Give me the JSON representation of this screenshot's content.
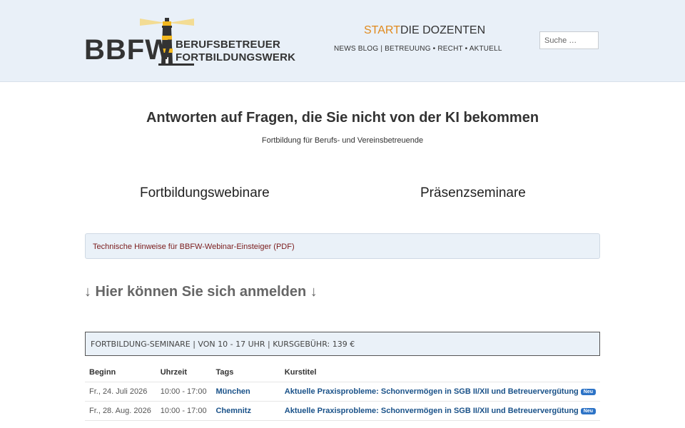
{
  "header": {
    "logo": {
      "mark": "BBFW",
      "line1": "BERUFSBETREUER",
      "line2": "FORTBILDUNGSWERK"
    },
    "nav": {
      "start": "START",
      "dozenten": "DIE DOZENTEN",
      "secondary": "NEWS BLOG | BETREUUNG • RECHT • AKTUELL"
    },
    "search": {
      "placeholder": "Suche …"
    },
    "colors": {
      "active": "#e08a1e",
      "background": "#e9f0f8"
    }
  },
  "main": {
    "headline": "Antworten auf Fragen, die Sie nicht von der KI bekommen",
    "subline": "Fortbildung für Berufs- und Vereinsbetreuende",
    "col_left": "Fortbildungswebinare",
    "col_right": "Präsenzseminare",
    "notice_link": "Technische Hinweise für BBFW-Webinar-Einsteiger (PDF)",
    "register": "↓ Hier können Sie sich anmelden ↓",
    "seminar_title": "FORTBILDUNG-SEMINARE | VON 10 - 17 UHR | KURSGEBÜHR: 139 €"
  },
  "table": {
    "headers": [
      "Beginn",
      "Uhrzeit",
      "Tags",
      "Kurstitel"
    ],
    "rows": [
      {
        "beginn": "Fr., 24. Juli 2026",
        "uhrzeit": "10:00 - 17:00",
        "tags": "München",
        "kurstitel": "Aktuelle Praxisprobleme: Schonvermögen in SGB II/XII und Betreuervergütung",
        "badge": "Neu"
      },
      {
        "beginn": "Fr., 28. Aug. 2026",
        "uhrzeit": "10:00 - 17:00",
        "tags": "Chemnitz",
        "kurstitel": "Aktuelle Praxisprobleme: Schonvermögen in SGB II/XII und Betreuervergütung",
        "badge": "Neu"
      }
    ]
  }
}
